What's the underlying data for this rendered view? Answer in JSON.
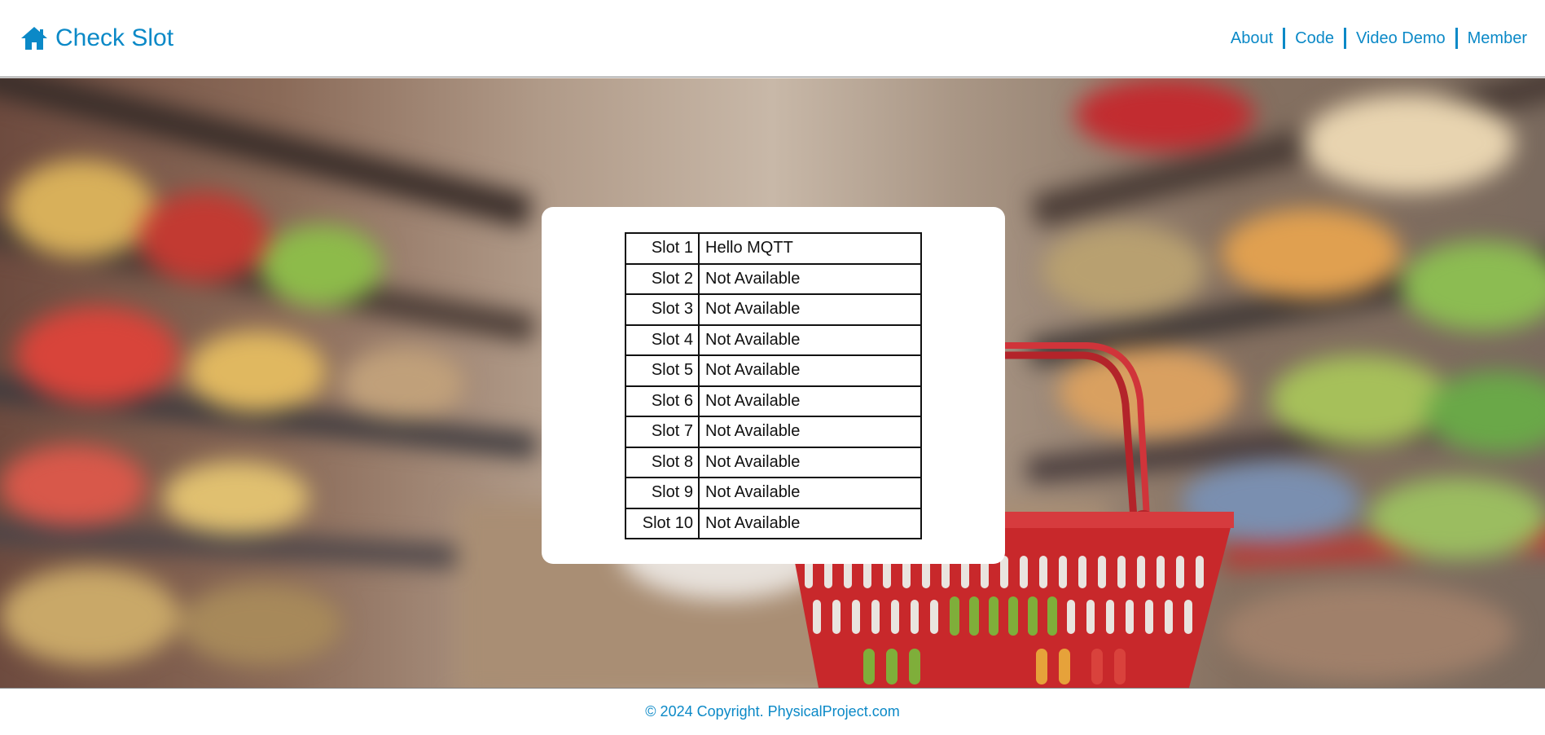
{
  "header": {
    "brand_icon": "home-icon",
    "title": "Check Slot",
    "nav": [
      {
        "label": "About"
      },
      {
        "label": "Code"
      },
      {
        "label": "Video Demo"
      },
      {
        "label": "Member"
      }
    ]
  },
  "slots": [
    {
      "label": "Slot 1",
      "value": "Hello MQTT"
    },
    {
      "label": "Slot 2",
      "value": "Not Available"
    },
    {
      "label": "Slot 3",
      "value": "Not Available"
    },
    {
      "label": "Slot 4",
      "value": "Not Available"
    },
    {
      "label": "Slot 5",
      "value": "Not Available"
    },
    {
      "label": "Slot 6",
      "value": "Not Available"
    },
    {
      "label": "Slot 7",
      "value": "Not Available"
    },
    {
      "label": "Slot 8",
      "value": "Not Available"
    },
    {
      "label": "Slot 9",
      "value": "Not Available"
    },
    {
      "label": "Slot 10",
      "value": "Not Available"
    }
  ],
  "footer": {
    "copyright": "© 2024 Copyright. PhysicalProject.com"
  },
  "colors": {
    "accent": "#0b89c7",
    "basket": "#c8282b"
  }
}
